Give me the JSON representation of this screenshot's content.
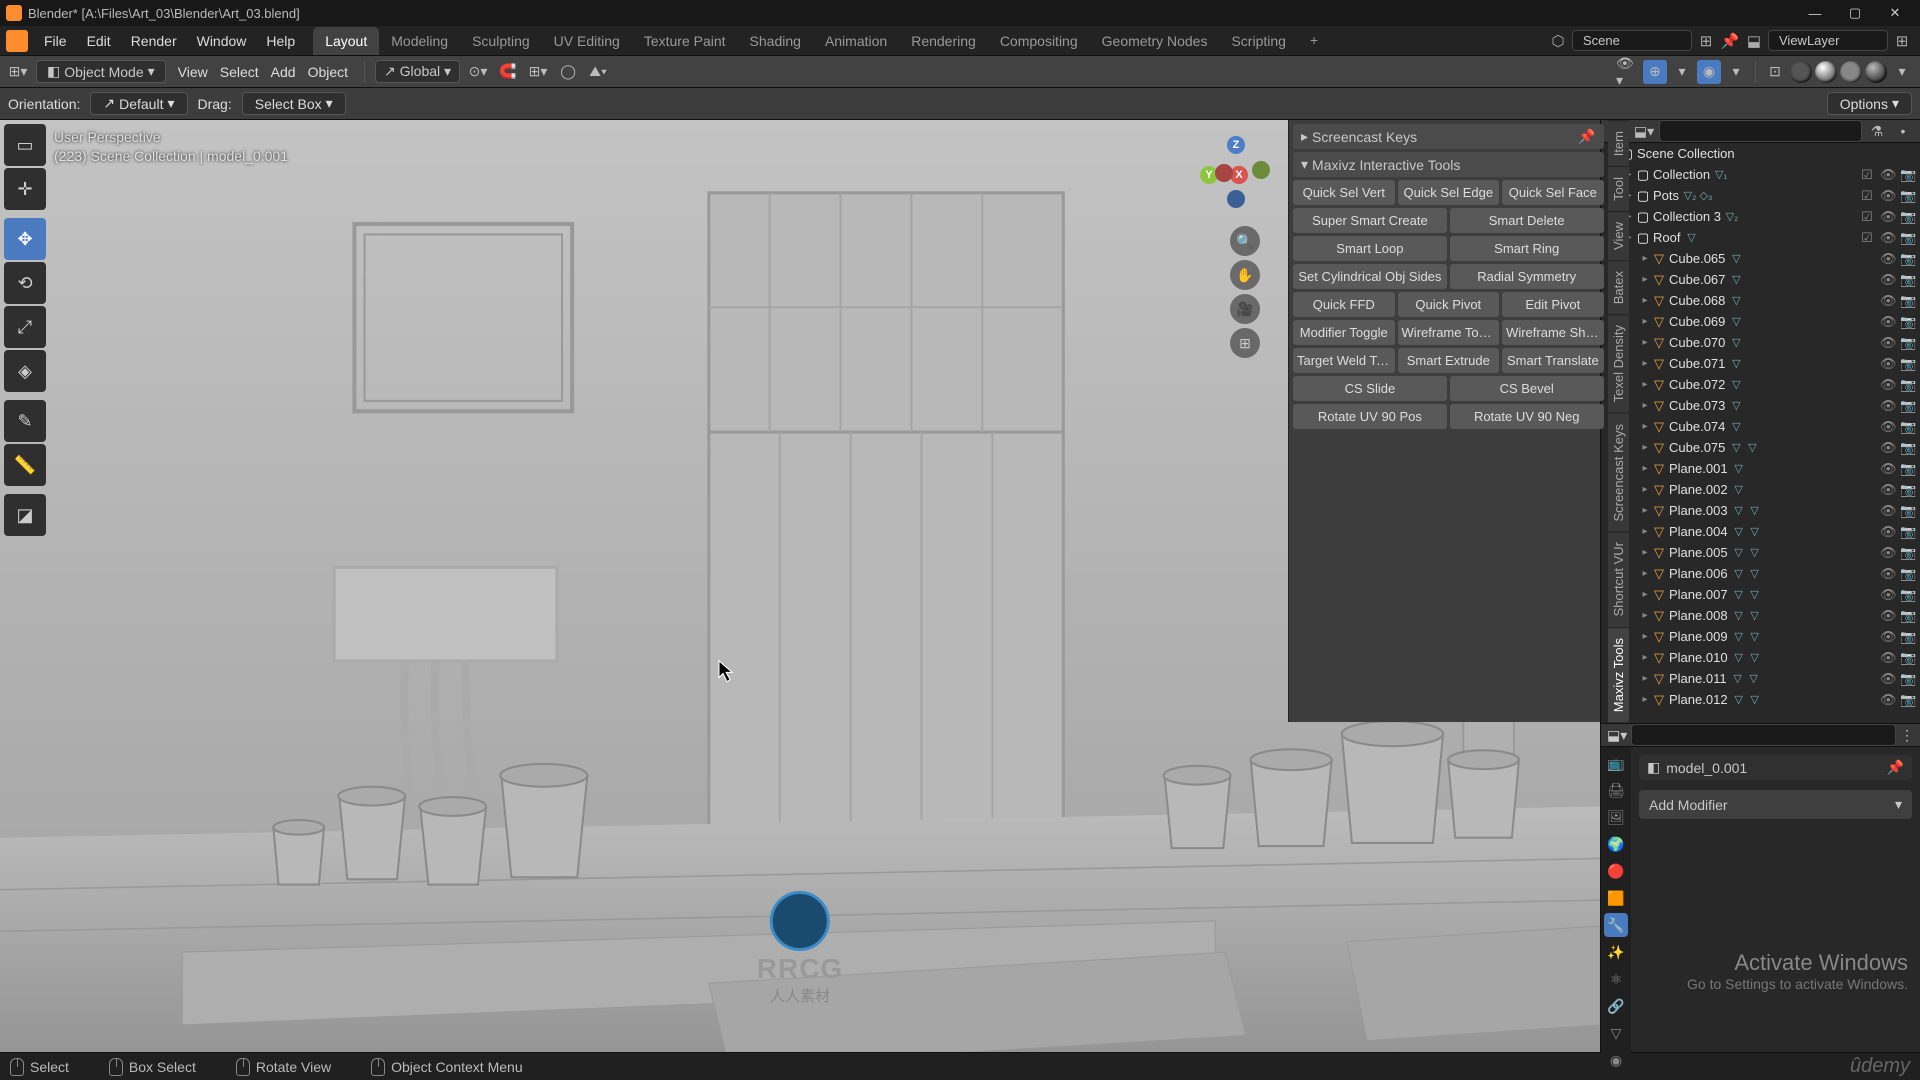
{
  "titlebar": {
    "title": "Blender* [A:\\Files\\Art_03\\Blender\\Art_03.blend]"
  },
  "topmenu": {
    "menus": [
      "File",
      "Edit",
      "Render",
      "Window",
      "Help"
    ],
    "tabs": [
      "Layout",
      "Modeling",
      "Sculpting",
      "UV Editing",
      "Texture Paint",
      "Shading",
      "Animation",
      "Rendering",
      "Compositing",
      "Geometry Nodes",
      "Scripting"
    ],
    "active_tab": 0,
    "scene_label": "Scene",
    "viewlayer_label": "ViewLayer"
  },
  "toolhdr": {
    "mode": "Object Mode",
    "menus": [
      "View",
      "Select",
      "Add",
      "Object"
    ],
    "transform": "Global"
  },
  "opthdr": {
    "orient_label": "Orientation:",
    "orient_value": "Default",
    "drag_label": "Drag:",
    "drag_value": "Select Box",
    "options_label": "Options"
  },
  "viewport": {
    "info_line1": "User Perspective",
    "info_line2": "(223) Scene Collection | model_0.001"
  },
  "sidepanel": {
    "header1": "Screencast Keys",
    "header2": "Maxivz Interactive Tools",
    "rows": [
      [
        "Quick Sel Vert",
        "Quick Sel Edge",
        "Quick Sel Face"
      ],
      [
        "Super Smart Create",
        "Smart Delete"
      ],
      [
        "Smart Loop",
        "Smart Ring"
      ],
      [
        "Set Cylindrical Obj Sides",
        "Radial Symmetry"
      ],
      [
        "Quick FFD",
        "Quick Pivot",
        "Edit Pivot"
      ],
      [
        "Modifier Toggle",
        "Wireframe Tog...",
        "Wireframe Sha..."
      ],
      [
        "Target Weld To...",
        "Smart Extrude",
        "Smart Translate"
      ],
      [
        "CS Slide",
        "CS Bevel"
      ],
      [
        "Rotate UV 90 Pos",
        "Rotate UV 90 Neg"
      ]
    ],
    "vtabs": [
      "Item",
      "Tool",
      "View",
      "Batex",
      "Texel Density",
      "Screencast Keys",
      "Shortcut VUr",
      "Maxivz Tools"
    ],
    "vtab_active": 7
  },
  "outliner": {
    "root": "Scene Collection",
    "collections": [
      {
        "name": "Collection",
        "badges": [
          "▽₁"
        ]
      },
      {
        "name": "Pots",
        "badges": [
          "▽₂",
          "◇₃"
        ]
      },
      {
        "name": "Collection 3",
        "badges": [
          "▽₂"
        ]
      },
      {
        "name": "Roof",
        "badges": [
          "▽"
        ]
      }
    ],
    "objects": [
      {
        "name": "Cube.065",
        "mesh": true
      },
      {
        "name": "Cube.067",
        "mesh": true
      },
      {
        "name": "Cube.068",
        "mesh": true
      },
      {
        "name": "Cube.069",
        "mesh": true
      },
      {
        "name": "Cube.070",
        "mesh": true
      },
      {
        "name": "Cube.071",
        "mesh": true
      },
      {
        "name": "Cube.072",
        "mesh": true
      },
      {
        "name": "Cube.073",
        "mesh": true
      },
      {
        "name": "Cube.074",
        "mesh": true
      },
      {
        "name": "Cube.075",
        "mesh": true,
        "extra": true
      },
      {
        "name": "Plane.001",
        "mesh": true
      },
      {
        "name": "Plane.002",
        "mesh": true
      },
      {
        "name": "Plane.003",
        "mesh": true,
        "extra": true
      },
      {
        "name": "Plane.004",
        "mesh": true,
        "extra": true
      },
      {
        "name": "Plane.005",
        "mesh": true,
        "extra": true
      },
      {
        "name": "Plane.006",
        "mesh": true,
        "extra": true
      },
      {
        "name": "Plane.007",
        "mesh": true,
        "extra": true
      },
      {
        "name": "Plane.008",
        "mesh": true,
        "extra": true
      },
      {
        "name": "Plane.009",
        "mesh": true,
        "extra": true
      },
      {
        "name": "Plane.010",
        "mesh": true,
        "extra": true
      },
      {
        "name": "Plane.011",
        "mesh": true,
        "extra": true
      },
      {
        "name": "Plane.012",
        "mesh": true,
        "extra": true
      }
    ]
  },
  "props": {
    "breadcrumb": "model_0.001",
    "add_modifier": "Add Modifier"
  },
  "watermark": {
    "title": "Activate Windows",
    "sub": "Go to Settings to activate Windows."
  },
  "statusbar": {
    "items": [
      "Select",
      "Box Select",
      "Rotate View",
      "Object Context Menu"
    ],
    "udemy": "ûdemy"
  },
  "centerlogo": {
    "txt1": "RRCG",
    "txt2": "人人素材"
  }
}
